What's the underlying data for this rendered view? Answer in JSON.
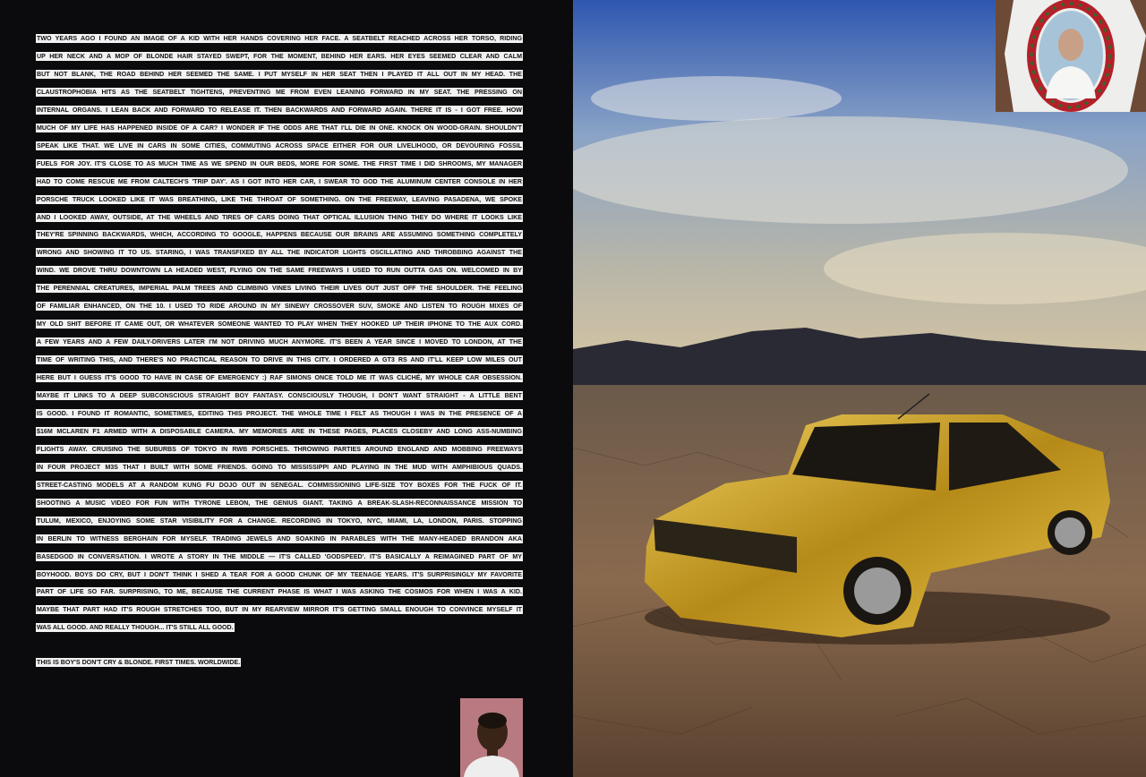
{
  "article": {
    "lines": [
      "TWO YEARS AGO I FOUND AN IMAGE OF A KID WITH HER HANDS COVERING HER FACE. A SEATBELT REACHED ACROSS HER TORSO, RIDING",
      "UP HER NECK AND A MOP OF BLONDE HAIR STAYED SWEPT, FOR THE MOMENT, BEHIND HER EARS. HER EYES SEEMED CLEAR AND CALM",
      "BUT NOT BLANK, THE ROAD BEHIND HER SEEMED THE SAME. I PUT MYSELF IN HER SEAT THEN I PLAYED IT ALL OUT IN MY HEAD. THE",
      "CLAUSTROPHOBIA HITS AS THE SEATBELT TIGHTENS, PREVENTING ME FROM EVEN LEANING FORWARD IN MY SEAT. THE PRESSING ON",
      "INTERNAL ORGANS. I LEAN BACK AND FORWARD TO RELEASE IT. THEN BACKWARDS AND FORWARD AGAIN. THERE IT IS - I GOT FREE. HOW",
      "MUCH OF MY LIFE HAS HAPPENED INSIDE OF A CAR? I WONDER IF THE ODDS ARE THAT I'LL DIE IN ONE. KNOCK ON WOOD-GRAIN. SHOULDN'T",
      "SPEAK LIKE THAT. WE LIVE IN CARS IN SOME CITIES, COMMUTING ACROSS SPACE EITHER FOR OUR LIVELIHOOD, OR DEVOURING FOSSIL",
      "FUELS FOR JOY. IT'S CLOSE TO AS MUCH TIME AS WE SPEND IN OUR BEDS, MORE FOR SOME. THE FIRST TIME I DID SHROOMS, MY MANAGER",
      "HAD TO COME RESCUE ME FROM CALTECH'S 'TRIP DAY'. AS I GOT INTO HER CAR, I SWEAR TO GOD THE ALUMINUM CENTER CONSOLE IN HER",
      "PORSCHE TRUCK LOOKED LIKE IT WAS BREATHING, LIKE THE THROAT OF SOMETHING. ON THE FREEWAY, LEAVING PASADENA, WE SPOKE",
      "AND I LOOKED AWAY, OUTSIDE, AT THE WHEELS AND TIRES OF CARS DOING THAT OPTICAL ILLUSION THING THEY DO WHERE IT LOOKS LIKE",
      "THEY'RE SPINNING BACKWARDS, WHICH, ACCORDING TO GOOGLE, HAPPENS BECAUSE OUR BRAINS ARE ASSUMING SOMETHING COMPLETELY",
      "WRONG AND SHOWING IT TO US. STARING, I WAS TRANSFIXED BY ALL THE INDICATOR LIGHTS OSCILLATING AND THROBBING AGAINST THE",
      "WIND. WE DROVE THRU DOWNTOWN LA HEADED WEST, FLYING ON THE SAME FREEWAYS I USED TO RUN OUTTA GAS ON. WELCOMED IN BY",
      "THE PERENNIAL CREATURES, IMPERIAL PALM TREES AND CLIMBING VINES LIVING THEIR LIVES OUT JUST OFF THE SHOULDER. THE FEELING",
      "OF FAMILIAR ENHANCED, ON THE 10. I USED TO RIDE AROUND IN MY SINEWY CROSSOVER SUV, SMOKE AND LISTEN TO ROUGH MIXES OF",
      "MY OLD SHIT BEFORE IT CAME OUT, OR WHATEVER SOMEONE WANTED TO PLAY WHEN THEY HOOKED UP THEIR IPHONE TO THE AUX CORD.",
      "A FEW YEARS AND A FEW DAILY-DRIVERS LATER I'M NOT DRIVING MUCH ANYMORE. IT'S BEEN A YEAR SINCE I MOVED TO LONDON, AT THE",
      "TIME OF WRITING THIS, AND THERE'S NO PRACTICAL REASON TO DRIVE IN THIS CITY. I ORDERED A GT3 RS AND IT'LL KEEP LOW MILES OUT",
      "HERE BUT I GUESS IT'S GOOD TO HAVE IN CASE OF EMERGENCY :) RAF SIMONS ONCE TOLD ME IT WAS CLICHÉ, MY WHOLE CAR OBSESSION.",
      "MAYBE IT LINKS TO A DEEP SUBCONSCIOUS STRAIGHT BOY FANTASY. CONSCIOUSLY THOUGH, I DON'T WANT STRAIGHT - A LITTLE BENT",
      "IS GOOD. I FOUND IT ROMANTIC, SOMETIMES, EDITING THIS PROJECT. THE WHOLE TIME I FELT AS THOUGH I WAS IN THE PRESENCE OF A",
      "$16M MCLAREN F1 ARMED WITH A DISPOSABLE CAMERA. MY MEMORIES ARE IN THESE PAGES, PLACES CLOSEBY AND LONG ASS-NUMBING",
      "FLIGHTS AWAY. CRUISING THE SUBURBS OF TOKYO IN RWB PORSCHES. THROWING PARTIES AROUND ENGLAND AND MOBBING FREEWAYS",
      "IN FOUR PROJECT M3S THAT I BUILT WITH SOME FRIENDS. GOING TO MISSISSIPPI AND PLAYING IN THE MUD WITH AMPHIBIOUS QUADS.",
      "STREET-CASTING MODELS AT A RANDOM KUNG FU DOJO OUT IN SENEGAL. COMMISSIONING LIFE-SIZE TOY BOXES FOR THE FUCK OF IT.",
      "SHOOTING A MUSIC VIDEO FOR FUN WITH TYRONE LEBON, THE GENIUS GIANT. TAKING A BREAK-SLASH-RECONNAISSANCE MISSION TO",
      "TULUM, MEXICO, ENJOYING SOME STAR VISIBILITY FOR A CHANGE. RECORDING IN TOKYO, NYC, MIAMI, LA, LONDON, PARIS. STOPPING",
      "IN BERLIN TO WITNESS BERGHAIN FOR MYSELF. TRADING JEWELS AND SOAKING IN PARABLES WITH THE MANY-HEADED BRANDON AKA",
      "BASEDGOD IN CONVERSATION. I WROTE A STORY IN THE MIDDLE — IT'S CALLED 'GODSPEED'. IT'S BASICALLY A REIMAGINED PART OF MY",
      "BOYHOOD. BOYS DO CRY, BUT I DON'T THINK I SHED A TEAR FOR A GOOD CHUNK OF MY TEENAGE YEARS. IT'S SURPRISINGLY MY FAVORITE",
      "PART OF LIFE SO FAR. SURPRISING, TO ME, BECAUSE THE CURRENT PHASE IS WHAT I WAS ASKING THE COSMOS FOR WHEN I WAS A KID.",
      "MAYBE THAT PART HAD IT'S ROUGH STRETCHES TOO, BUT IN MY REARVIEW MIRROR IT'S GETTING SMALL ENOUGH TO CONVINCE MYSELF IT",
      "WAS ALL GOOD. AND REALLY THOUGH... IT'S STILL ALL GOOD."
    ],
    "closing": "THIS IS BOY'S DON'T CRY & BLONDE. FIRST TIMES. WORLDWIDE."
  },
  "images": {
    "main_photo": "gold-car-desert-photo",
    "inset_top": "memorial-tshirt-photo",
    "inset_bottom": "child-portrait-photo"
  },
  "colors": {
    "page_bg": "#0b0b0d",
    "highlight": "#f2f2f2",
    "car_gold": "#c9a020"
  }
}
